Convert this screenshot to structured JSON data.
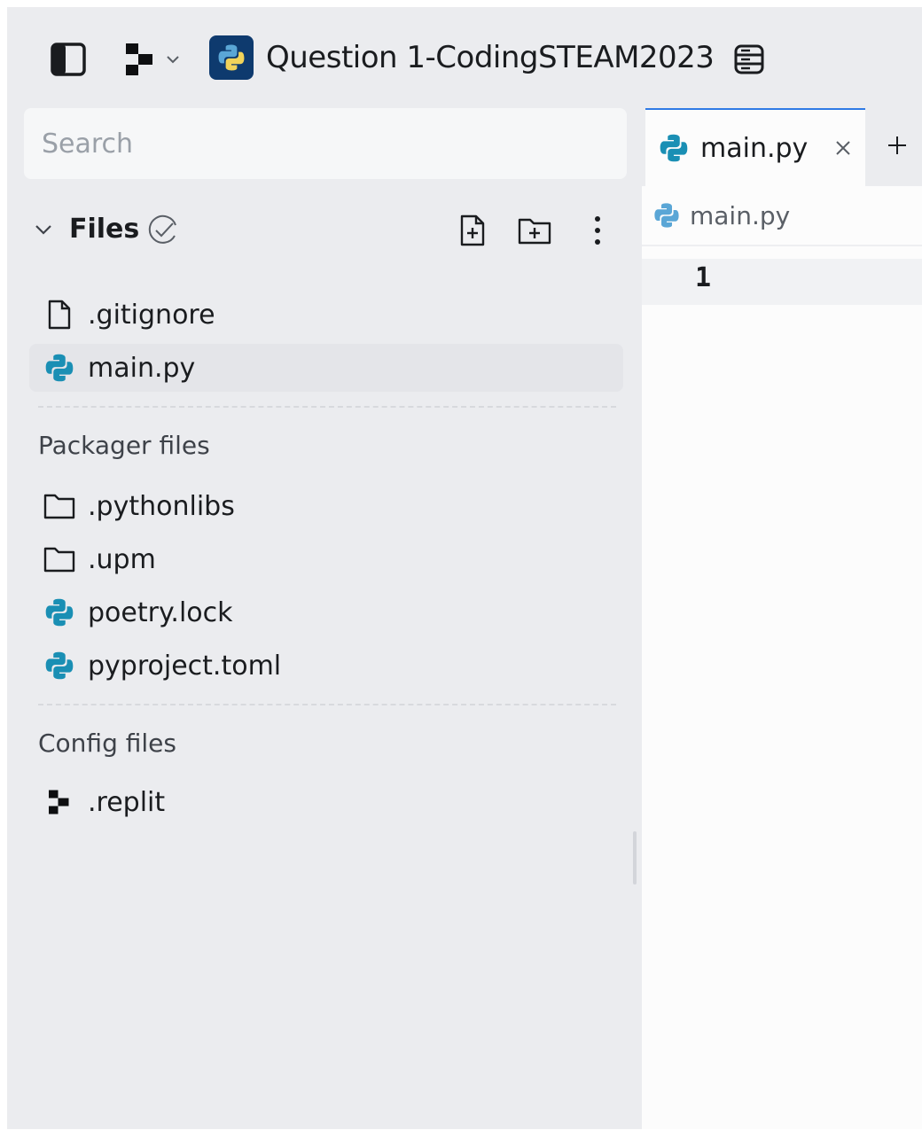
{
  "header": {
    "repl_title": "Question 1-CodingSTEAM2023"
  },
  "sidebar": {
    "search_placeholder": "Search",
    "files_label": "Files",
    "files": [
      {
        "name": ".gitignore",
        "icon": "file-icon"
      },
      {
        "name": "main.py",
        "icon": "python-icon",
        "active": true
      }
    ],
    "packager_label": "Packager files",
    "packager_files": [
      {
        "name": ".pythonlibs",
        "icon": "folder-icon"
      },
      {
        "name": ".upm",
        "icon": "folder-icon"
      },
      {
        "name": "poetry.lock",
        "icon": "python-icon"
      },
      {
        "name": "pyproject.toml",
        "icon": "python-icon"
      }
    ],
    "config_label": "Config files",
    "config_files": [
      {
        "name": ".replit",
        "icon": "replit-icon"
      }
    ]
  },
  "editor": {
    "tab_label": "main.py",
    "breadcrumb": "main.py",
    "line_numbers": [
      "1"
    ]
  },
  "colors": {
    "accent": "#2f7ae5",
    "python_teal": "#1a8fb4",
    "sidebar_bg": "#ebecef"
  }
}
